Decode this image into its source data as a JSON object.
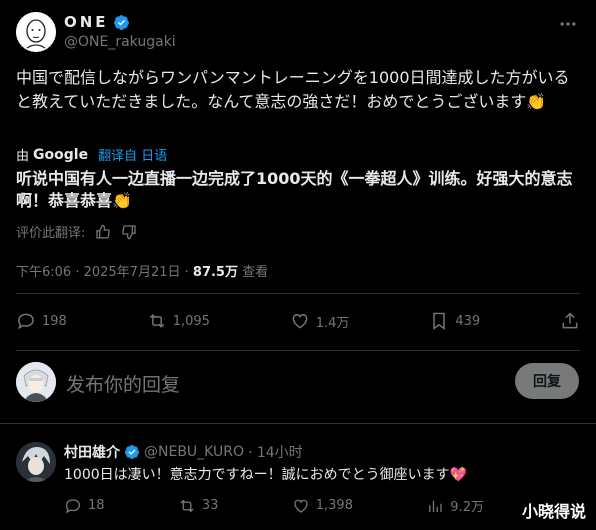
{
  "author": {
    "name": "ONE",
    "handle": "@ONE_rakugaki"
  },
  "tweet": {
    "text": "中国で配信しながらワンパンマントレーニングを1000日間達成した方がいると教えていただきました。なんて意志の強さだ！おめでとうございます👏",
    "translated_by_prefix": "由",
    "translated_by_brand": "Google",
    "translate_link": "翻译自 日语",
    "translated_text": "听说中国有人一边直播一边完成了1000天的《一拳超人》训练。好强大的意志啊！恭喜恭喜👏",
    "rate_label": "评价此翻译:",
    "time": "下午6:06 · 2025年7月21日 ·",
    "views": "87.5万",
    "views_label": "查看"
  },
  "actions": {
    "replies": "198",
    "retweets": "1,095",
    "likes": "1.4万",
    "bookmarks": "439"
  },
  "reply_box": {
    "placeholder": "发布你的回复",
    "button": "回复"
  },
  "comment": {
    "name": "村田雄介",
    "handle": "@NEBU_KURO",
    "time": "· 14小时",
    "text": "1000日は凄い！意志力ですねー！誠におめでとう御座います💖",
    "replies": "18",
    "retweets": "33",
    "likes": "1,398",
    "views": "9.2万"
  },
  "watermark": "小晓得说",
  "colors": {
    "background": "#000000",
    "text": "#e7e9ea",
    "muted": "#71767b",
    "accent": "#1d9bf0",
    "divider": "#2f3336"
  }
}
